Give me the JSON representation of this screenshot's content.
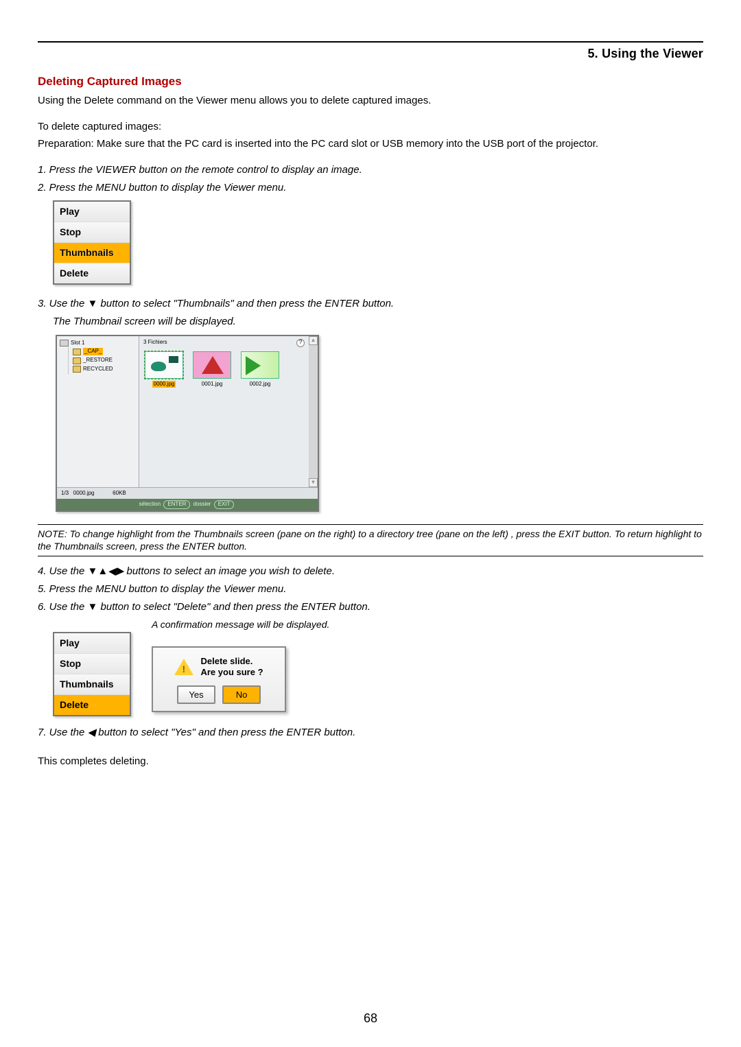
{
  "chapter": "5. Using the Viewer",
  "section": "Deleting Captured Images",
  "intro": "Using the Delete command on the Viewer menu allows you to delete captured images.",
  "prep1": "To delete captured images:",
  "prep2": "Preparation: Make sure that the PC card is inserted into the PC card slot or USB memory into the USB port of the projector.",
  "steps": {
    "s1": "1.  Press the VIEWER button on the remote control to display an image.",
    "s2": "2.  Press the MENU button to display the Viewer menu.",
    "s3a": "3.  Use the ▼ button to select \"Thumbnails\" and then press the ENTER button.",
    "s3b": "The Thumbnail screen will be displayed.",
    "s4": "4.  Use the ▼▲◀▶ buttons to select an image you wish to delete.",
    "s5": "5.  Press the MENU button to display the Viewer menu.",
    "s6": "6.  Use the ▼ button to select \"Delete\" and then press the ENTER button.",
    "s7": "7.  Use the ◀ button to select \"Yes\" and then press the ENTER button."
  },
  "menuA": {
    "play": "Play",
    "stop": "Stop",
    "thumbnails": "Thumbnails",
    "delete": "Delete"
  },
  "viewer": {
    "slot": "Slot 1",
    "node_cap": "_CAP_",
    "node_restore": "_RESTORE",
    "node_recycled": "RECYCLED",
    "file_count": "3 Fichiers",
    "thumbs": {
      "f0": "0000.jpg",
      "f1": "0001.jpg",
      "f2": "0002.jpg"
    },
    "status_index": "1/3",
    "status_name": "0000.jpg",
    "status_size": "60KB",
    "hint_sel": "sélection",
    "hint_enter": "ENTER",
    "hint_dossier": "dossier",
    "hint_exit": "EXIT"
  },
  "note": "NOTE: To change highlight from the Thumbnails screen (pane on the right) to a directory tree (pane on the left) , press the EXIT button. To return highlight to the Thumbnails screen, press the ENTER button.",
  "confirm_caption": "A confirmation message will be displayed.",
  "dialog": {
    "line1": "Delete slide.",
    "line2": "Are you sure ?",
    "yes": "Yes",
    "no": "No"
  },
  "closing": "This completes deleting.",
  "page_number": "68"
}
